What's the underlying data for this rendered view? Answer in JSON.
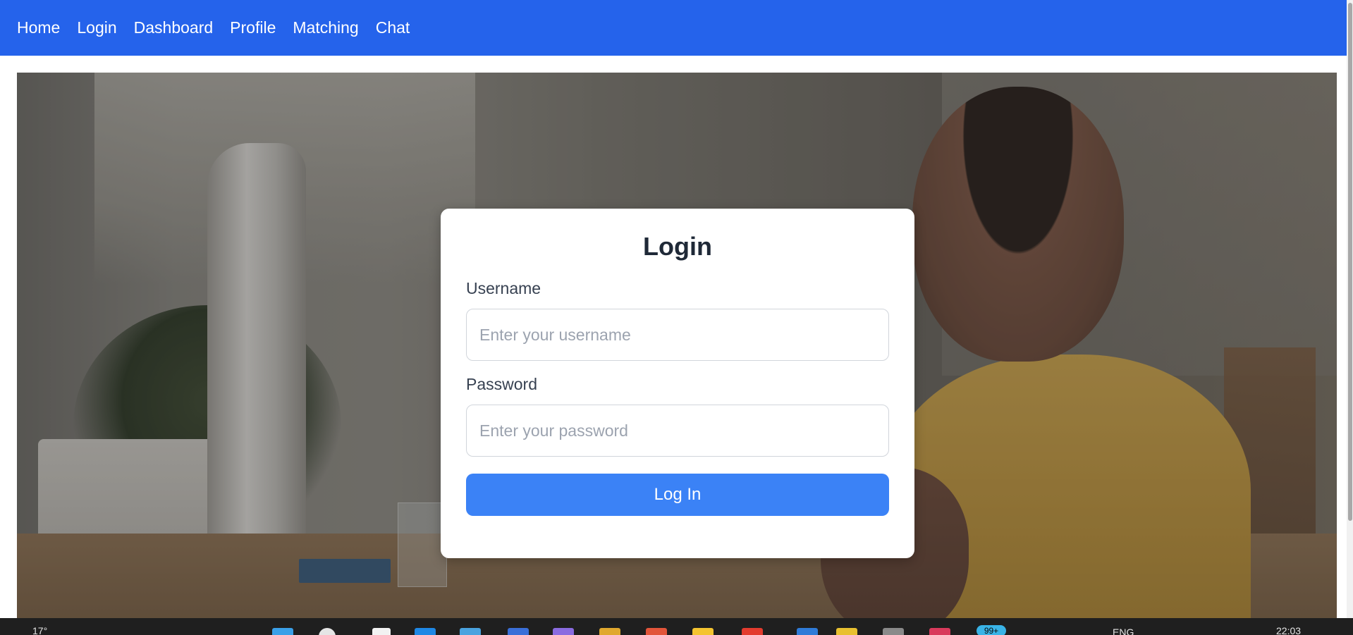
{
  "nav": {
    "items": [
      {
        "label": "Home"
      },
      {
        "label": "Login"
      },
      {
        "label": "Dashboard"
      },
      {
        "label": "Profile"
      },
      {
        "label": "Matching"
      },
      {
        "label": "Chat"
      }
    ]
  },
  "login_card": {
    "title": "Login",
    "username": {
      "label": "Username",
      "placeholder": "Enter your username",
      "value": ""
    },
    "password": {
      "label": "Password",
      "placeholder": "Enter your password",
      "value": ""
    },
    "submit_label": "Log In"
  },
  "taskbar": {
    "weather": "17°",
    "language": "ENG",
    "time": "22:03",
    "notification_badge": "99+"
  },
  "colors": {
    "navbar": "#2563eb",
    "button": "#3b82f6",
    "title_text": "#1f2937"
  }
}
